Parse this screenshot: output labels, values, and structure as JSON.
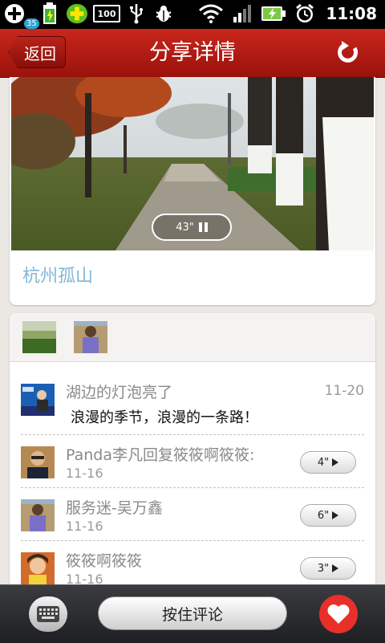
{
  "status_bar": {
    "notification_count": "35",
    "battery_app_label": "100",
    "time": "11:08",
    "icons": [
      "add-icon",
      "battery-charging-icon",
      "green-app-icon",
      "battery-100-icon",
      "usb-icon",
      "bug-icon",
      "wifi-icon",
      "signal-icon",
      "charging-icon",
      "alarm-icon"
    ]
  },
  "header": {
    "back_label": "返回",
    "title": "分享详情",
    "refresh_icon": "refresh-icon"
  },
  "photo": {
    "audio_duration": "43\"",
    "location": "杭州孤山"
  },
  "feed": {
    "items": [
      {
        "name": "湖边的灯泡亮了",
        "date": "11-20",
        "message": "浪漫的季节，浪漫的一条路！"
      },
      {
        "name": "Panda李凡回复筱筱啊筱筱:",
        "date": "11-16",
        "voice_length": "4\""
      },
      {
        "name": "服务迷-吴万鑫",
        "date": "11-16",
        "voice_length": "6\""
      },
      {
        "name": "筱筱啊筱筱",
        "date": "11-16",
        "voice_length": "3\""
      }
    ]
  },
  "bottom_bar": {
    "comment_label": "按住评论"
  },
  "colors": {
    "header_red": "#b01a12",
    "location_blue": "#7fb8d6",
    "like_red": "#e8302a"
  }
}
